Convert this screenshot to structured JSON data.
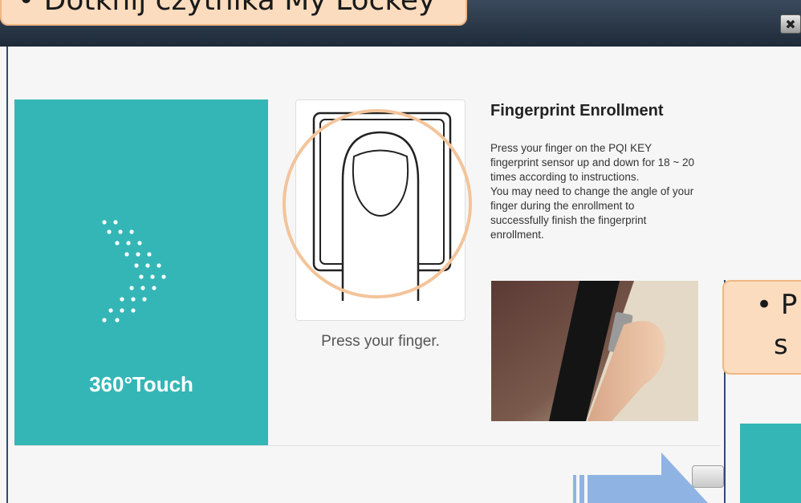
{
  "window": {
    "close_glyph": "✖"
  },
  "left_panel": {
    "brand": "360°Touch",
    "icon": "dotted-chevron-icon"
  },
  "finger": {
    "caption": "Press your finger.",
    "icon": "fingerprint-finger-icon"
  },
  "info": {
    "title": "Fingerprint Enrollment",
    "lines": [
      "Press your finger on the PQI KEY",
      "fingerprint sensor up and down for 18 ~ 20",
      "times according to instructions.",
      "You may need to change the angle of your",
      "finger during the enrollment to",
      "successfully finish the fingerprint",
      "enrollment."
    ]
  },
  "overlay": {
    "top_callout": "• Dotknij czytnika My Lockey",
    "right_callout_line1": "• P",
    "right_callout_line2": "s"
  },
  "colors": {
    "teal": "#35b6b6",
    "callout": "#fbdcbe",
    "ring": "#f3c49a",
    "arrow": "#8fb4e3"
  }
}
